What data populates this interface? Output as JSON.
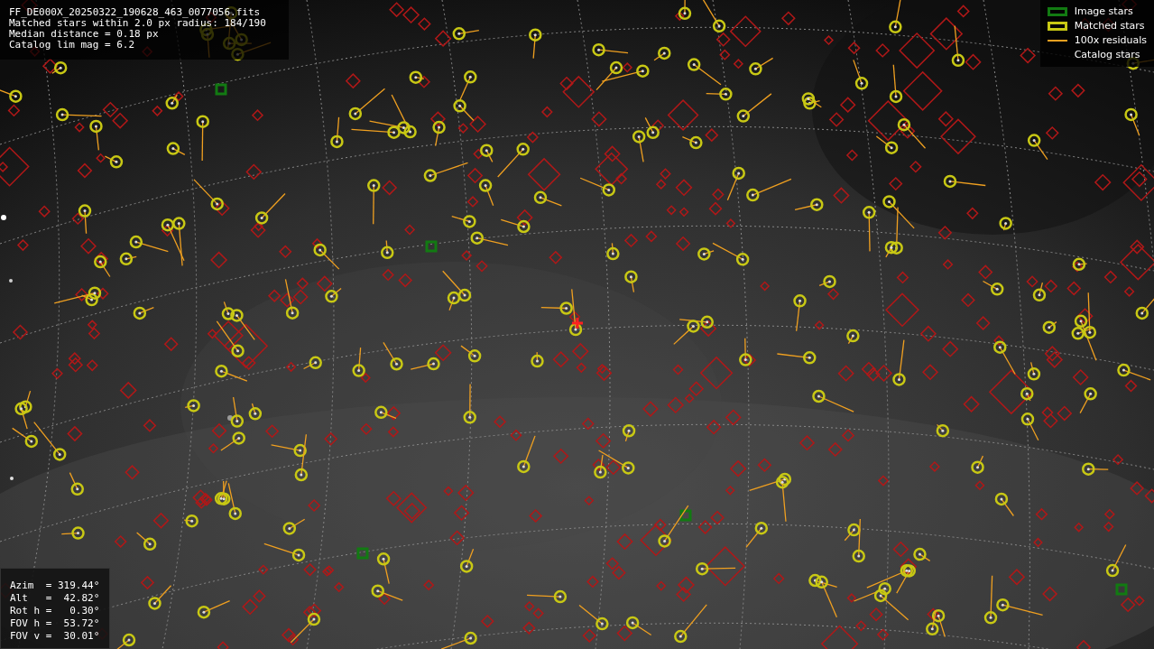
{
  "info": {
    "lines": [
      "FF_DE000X_20250322_190628_463_0077056.fits",
      "Matched stars within 2.0 px radius: 184/190",
      "Median distance = 0.18 px",
      "Catalog lim mag = 6.2"
    ]
  },
  "legend": [
    {
      "label": "Image stars",
      "kind": "box",
      "color": "#127a12"
    },
    {
      "label": "Matched stars",
      "kind": "box",
      "color": "#c8c814"
    },
    {
      "label": "100x residuals",
      "kind": "line",
      "color": "#f0a020"
    },
    {
      "label": "Catalog stars",
      "kind": "blank"
    }
  ],
  "pointing": {
    "lines": [
      "Azim  = 319.44°",
      "Alt   =  42.82°",
      "Rot h =   0.30°",
      "FOV h =  53.72°",
      "FOV v =  30.01°"
    ]
  }
}
